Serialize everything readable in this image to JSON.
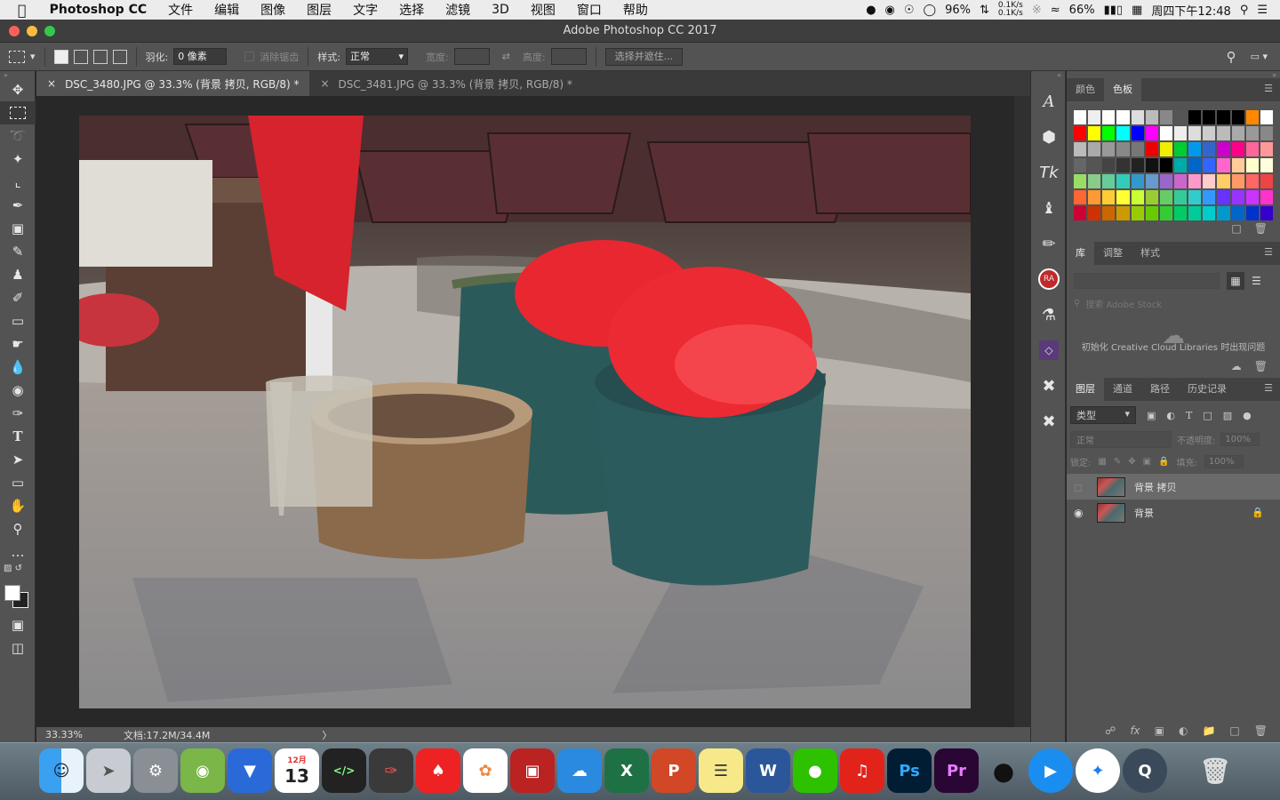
{
  "menubar": {
    "apple": "",
    "app_name": "Photoshop CC",
    "items": [
      "文件",
      "编辑",
      "图像",
      "图层",
      "文字",
      "选择",
      "滤镜",
      "3D",
      "视图",
      "窗口",
      "帮助"
    ],
    "battery_pct": "96%",
    "net_up": "0.1K/s",
    "net_down": "0.1K/s",
    "wifi_battery": "66%",
    "clock": "周四下午12:48"
  },
  "window": {
    "title": "Adobe Photoshop CC 2017"
  },
  "options": {
    "feather_label": "羽化:",
    "feather_value": "0 像素",
    "antialias_label": "消除锯齿",
    "style_label": "样式:",
    "style_value": "正常",
    "width_label": "宽度:",
    "height_label": "高度:",
    "select_mask_button": "选择并遮住..."
  },
  "tabs": [
    {
      "label": "DSC_3480.JPG @ 33.3% (背景 拷贝, RGB/8) *",
      "close": "×"
    },
    {
      "label": "DSC_3481.JPG @ 33.3% (背景 拷贝, RGB/8) *",
      "close": "×"
    }
  ],
  "status": {
    "zoom": "33.33%",
    "doc": "文档:17.2M/34.4M",
    "arrow": "〉"
  },
  "swatch_panel": {
    "tabs": [
      "颜色",
      "色板"
    ]
  },
  "library_panel": {
    "tabs": [
      "库",
      "调整",
      "样式"
    ],
    "search_placeholder": "搜索 Adobe Stock",
    "message": "初始化 Creative Cloud Libraries 时出现问题"
  },
  "layers_panel": {
    "tabs": [
      "图层",
      "通道",
      "路径",
      "历史记录"
    ],
    "filter": "类型",
    "blend_mode": "正常",
    "opacity_label": "不透明度:",
    "opacity_value": "100%",
    "lock_label": "锁定:",
    "fill_label": "填充:",
    "fill_value": "100%",
    "layers": [
      {
        "name": "背景 拷贝",
        "selected": true,
        "visible": false,
        "locked": false
      },
      {
        "name": "背景",
        "selected": false,
        "visible": true,
        "locked": true
      }
    ]
  },
  "dock": {
    "calendar_month": "12月",
    "calendar_day": "13",
    "ps": "Ps",
    "pr": "Pr"
  },
  "colors": {
    "accent": "#1473e6",
    "panel_bg": "#535353",
    "canvas_bg": "#282828"
  }
}
